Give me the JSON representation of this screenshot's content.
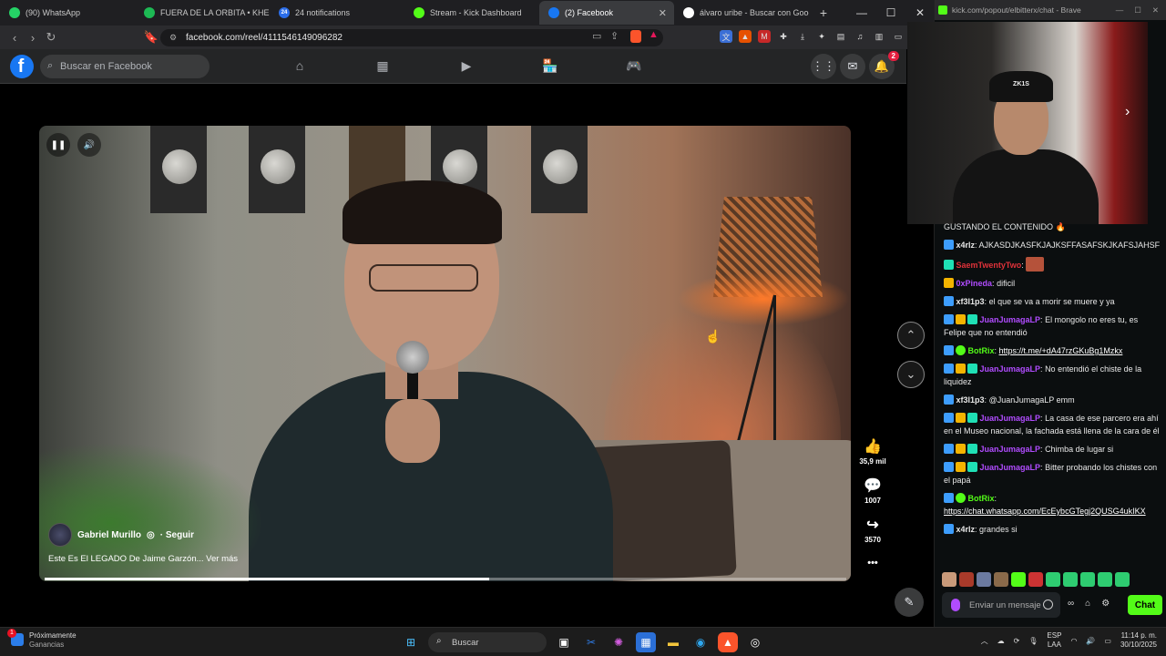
{
  "browser": {
    "tabs": [
      {
        "label": "(90) WhatsApp",
        "icon": "whatsapp-icon",
        "color": "#25d366"
      },
      {
        "label": "FUERA DE LA ORBITA • KHE",
        "icon": "spotify-icon",
        "color": "#1db954"
      },
      {
        "label": "24 notifications",
        "icon": "notifications-icon",
        "color": "#2b6de9",
        "badge": "24"
      },
      {
        "label": "Stream - Kick Dashboard",
        "icon": "kick-icon",
        "color": "#53fc18"
      },
      {
        "label": "(2) Facebook",
        "icon": "facebook-icon",
        "color": "#1877f2",
        "active": true
      },
      {
        "label": "álvaro uribe - Buscar con Google",
        "icon": "google-icon",
        "color": "#ffffff"
      }
    ],
    "new_tab": "+",
    "url": "facebook.com/reel/4111546149096282"
  },
  "facebook": {
    "logo": "f",
    "search_placeholder": "Buscar en Facebook",
    "notification_count": "2"
  },
  "reel": {
    "author": "Gabriel Murillo",
    "follow": "· Seguir",
    "description": "Este Es El LEGADO De Jaime Garzón... Ver más",
    "likes": "35,9 mil",
    "comments": "1007",
    "shares": "3570",
    "more": "•••",
    "progress_fraction": 0.555
  },
  "kick": {
    "popout_url": "kick.com/popout/elbitterx/chat - Brave",
    "cam_cap_text": "ZK1S",
    "messages": [
      {
        "user": "",
        "text": "GUSTANDO EL CONTENIDO 🔥",
        "color": "#ffffff",
        "badges": []
      },
      {
        "user": "x4rlz",
        "text": "AJKASDJKASFKJAJKSFFASAFSKJKAFSJAHSF",
        "color": "#e8e8e8",
        "badges": [
          "sub"
        ]
      },
      {
        "user": "SaemTwentyTwo",
        "text": "",
        "color": "#e0323a",
        "badges": [
          "mod"
        ]
      },
      {
        "user": "0xPineda",
        "text": "dificil",
        "color": "#b14cff",
        "badges": [
          "crown"
        ]
      },
      {
        "user": "xf3l1p3",
        "text": "el que se va a morir se muere y ya",
        "color": "#e8e8e8",
        "badges": [
          "sub"
        ]
      },
      {
        "user": "JuanJumagaLP",
        "text": "El mongolo no eres tu, es Felipe que no entendió",
        "color": "#b14cff",
        "badges": [
          "sub",
          "crown",
          "mod"
        ]
      },
      {
        "user": "BotRix",
        "text": "https://t.me/+dA47rzGKuBg1Mzkx",
        "color": "#53fc18",
        "badges": [
          "sub",
          "bot"
        ],
        "link": true
      },
      {
        "user": "JuanJumagaLP",
        "text": "No entendió el chiste de la liquidez",
        "color": "#b14cff",
        "badges": [
          "sub",
          "crown",
          "mod"
        ]
      },
      {
        "user": "xf3l1p3",
        "text": "@JuanJumagaLP emm",
        "color": "#e8e8e8",
        "badges": [
          "sub"
        ]
      },
      {
        "user": "JuanJumagaLP",
        "text": "La casa de ese parcero era ahí en el Museo nacional, la fachada está llena de la cara de él",
        "color": "#b14cff",
        "badges": [
          "sub",
          "crown",
          "mod"
        ]
      },
      {
        "user": "JuanJumagaLP",
        "text": "Chimba de lugar si",
        "color": "#b14cff",
        "badges": [
          "sub",
          "crown",
          "mod"
        ]
      },
      {
        "user": "JuanJumagaLP",
        "text": "Bitter probando los chistes con el papá",
        "color": "#b14cff",
        "badges": [
          "sub",
          "crown",
          "mod"
        ]
      },
      {
        "user": "BotRix",
        "text": "https://chat.whatsapp.com/EcEybcGTegj2QUSG4ukIKX",
        "color": "#53fc18",
        "badges": [
          "sub",
          "bot"
        ],
        "link": true,
        "newline": true
      },
      {
        "user": "x4rlz",
        "text": "grandes si",
        "color": "#e8e8e8",
        "badges": [
          "sub"
        ]
      }
    ],
    "input_placeholder": "Enviar un mensaje",
    "chat_button": "Chat"
  },
  "taskbar": {
    "weather_title": "Próximamente",
    "weather_sub": "Ganancias",
    "weather_badge": "1",
    "search_placeholder": "Buscar",
    "lang_top": "ESP",
    "lang_bottom": "LAA",
    "time": "11:14 p. m.",
    "date": "30/10/2025"
  }
}
